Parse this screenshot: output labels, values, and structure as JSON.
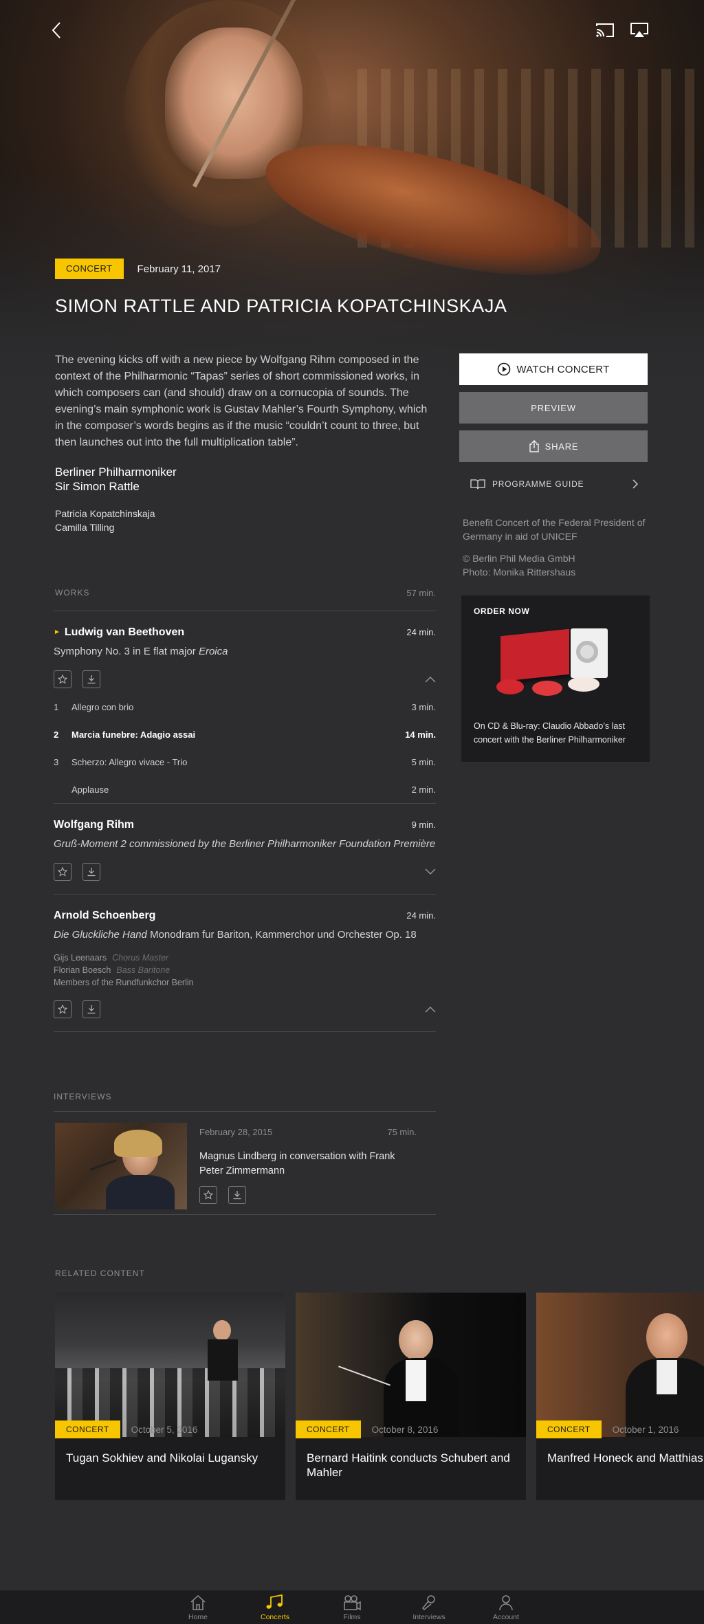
{
  "hero": {
    "badge": "CONCERT",
    "date": "February 11, 2017",
    "title": "SIMON RATTLE AND PATRICIA KOPATCHINSKAJA"
  },
  "description": "The evening kicks off with a new piece by Wolfgang Rihm composed in the context of the Philharmonic “Tapas” series of short commissioned works, in which composers can (and should) draw on a cornucopia of sounds. The evening’s main symphonic work is Gustav Mahler’s Fourth Symphony, which in the composer’s words begins as if the music “couldn’t count to three, but then launches out into the full multiplication table”.",
  "performers_main": [
    "Berliner Philharmoniker",
    "Sir Simon Rattle"
  ],
  "performers_sub": [
    "Patricia Kopatchinskaja",
    "Camilla Tilling"
  ],
  "actions": {
    "watch": "WATCH CONCERT",
    "preview": "PREVIEW",
    "share": "SHARE",
    "guide": "PROGRAMME GUIDE"
  },
  "info": {
    "benefit": "Benefit Concert of the Federal President of Germany in aid of UNICEF",
    "copyright": "© Berlin Phil Media GmbH",
    "photo": "Photo: Monika Rittershaus"
  },
  "order": {
    "title": "ORDER NOW",
    "text": "On CD & Blu-ray: Claudio Abbado’s last concert with the Berliner Philharmoniker"
  },
  "works": {
    "label": "WORKS",
    "total": "57 min.",
    "items": [
      {
        "composer": "Ludwig van Beethoven",
        "duration": "24 min.",
        "piece": "Symphony No. 3 in E flat major",
        "piece_italic": "Eroica",
        "movements": [
          {
            "num": "1",
            "title": "Allegro con brio",
            "duration": "3 min."
          },
          {
            "num": "2",
            "title": "Marcia funebre: Adagio assai",
            "duration": "14 min."
          },
          {
            "num": "3",
            "title": "Scherzo: Allegro vivace - Trio",
            "duration": "5 min."
          },
          {
            "num": "",
            "title": "Applause",
            "duration": "2 min."
          }
        ]
      },
      {
        "composer": "Wolfgang Rihm",
        "duration": "9 min.",
        "piece_italic": "Gruß-Moment 2 commissioned by the Berliner Philharmoniker Foundation Première"
      },
      {
        "composer": "Arnold Schoenberg",
        "duration": "24 min.",
        "piece_italic": "Die Gluckliche Hand",
        "piece": "Monodram fur Bariton, Kammerchor und Orchester Op. 18",
        "contributors": [
          {
            "name": "Gijs Leenaars",
            "role": "Chorus Master"
          },
          {
            "name": "Florian Boesch",
            "role": "Bass Baritone"
          },
          {
            "name": "Members of the Rundfunkchor Berlin",
            "role": ""
          }
        ]
      }
    ]
  },
  "interviews": {
    "label": "INTERVIEWS",
    "item": {
      "date": "February 28, 2015",
      "duration": "75 min.",
      "title": "Magnus Lindberg in conversation with Frank Peter Zimmermann"
    }
  },
  "related": {
    "label": "RELATED CONTENT",
    "cards": [
      {
        "badge": "CONCERT",
        "date": "October 5, 2016",
        "title": "Tugan Sokhiev and Nikolai Lugansky"
      },
      {
        "badge": "CONCERT",
        "date": "October 8, 2016",
        "title": "Bernard Haitink conducts Schubert and Mahler"
      },
      {
        "badge": "CONCERT",
        "date": "October 1, 2016",
        "title": "Manfred Honeck and Matthias Goerne"
      }
    ]
  },
  "tabs": [
    {
      "label": "Home",
      "icon": "home-icon"
    },
    {
      "label": "Concerts",
      "icon": "music-note-icon",
      "active": true
    },
    {
      "label": "Films",
      "icon": "film-camera-icon"
    },
    {
      "label": "Interviews",
      "icon": "microphone-icon"
    },
    {
      "label": "Account",
      "icon": "person-icon"
    }
  ],
  "colors": {
    "accent": "#f7c600",
    "background": "#2d2d2f",
    "card": "#1c1c1e"
  }
}
